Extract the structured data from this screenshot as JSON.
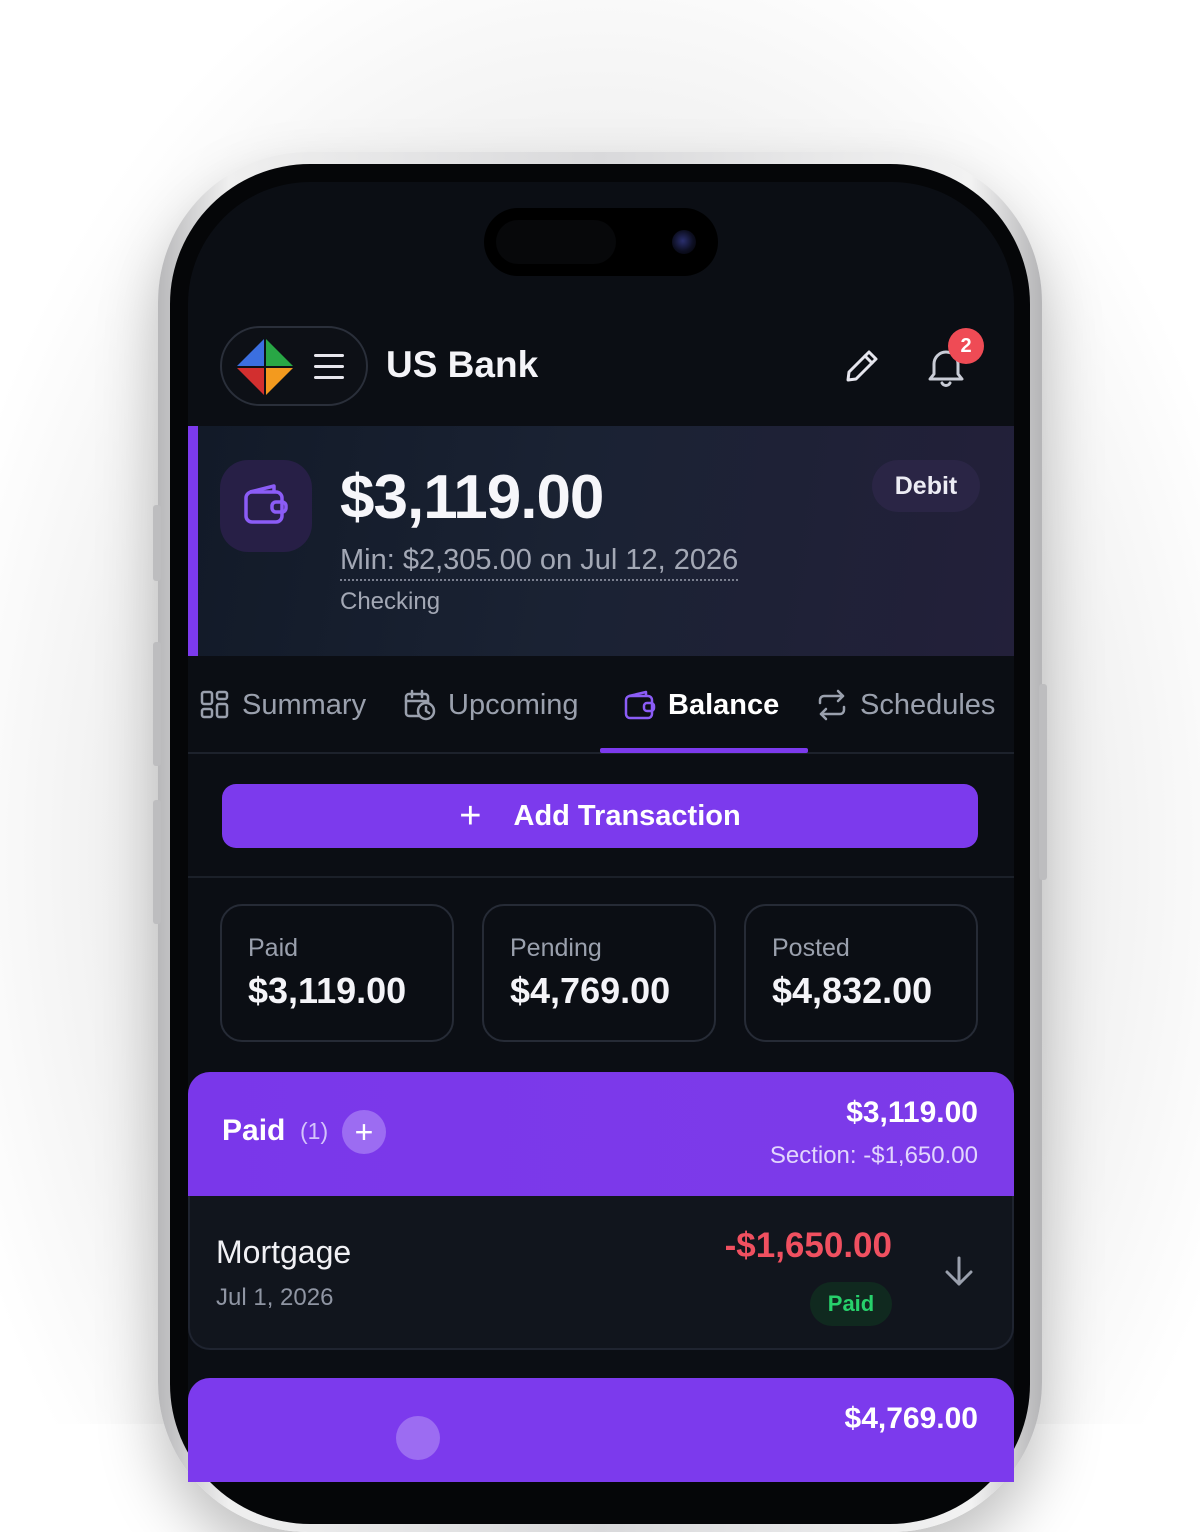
{
  "app": {
    "bank_name": "US Bank",
    "notification_count": "2"
  },
  "account": {
    "balance": "$3,119.00",
    "min_line": "Min: $2,305.00 on Jul 12, 2026",
    "type": "Checking",
    "badge": "Debit"
  },
  "tabs": [
    {
      "label": "Summary",
      "icon": "grid-icon"
    },
    {
      "label": "Upcoming",
      "icon": "calendar-clock-icon"
    },
    {
      "label": "Balance",
      "icon": "wallet-icon",
      "active": true
    },
    {
      "label": "Schedules",
      "icon": "repeat-icon"
    }
  ],
  "actions": {
    "add_transaction": "Add Transaction"
  },
  "stats": [
    {
      "label": "Paid",
      "value": "$3,119.00"
    },
    {
      "label": "Pending",
      "value": "$4,769.00"
    },
    {
      "label": "Posted",
      "value": "$4,832.00"
    }
  ],
  "sections": [
    {
      "title": "Paid",
      "count": "(1)",
      "total": "$3,119.00",
      "subtotal": "Section: -$1,650.00",
      "transactions": [
        {
          "name": "Mortgage",
          "date": "Jul 1, 2026",
          "amount": "-$1,650.00",
          "status": "Paid"
        }
      ]
    },
    {
      "total": "$4,769.00"
    }
  ],
  "colors": {
    "accent": "#7c3aed",
    "negative": "#f05060",
    "success": "#27d06b",
    "badge": "#ef4b55"
  }
}
